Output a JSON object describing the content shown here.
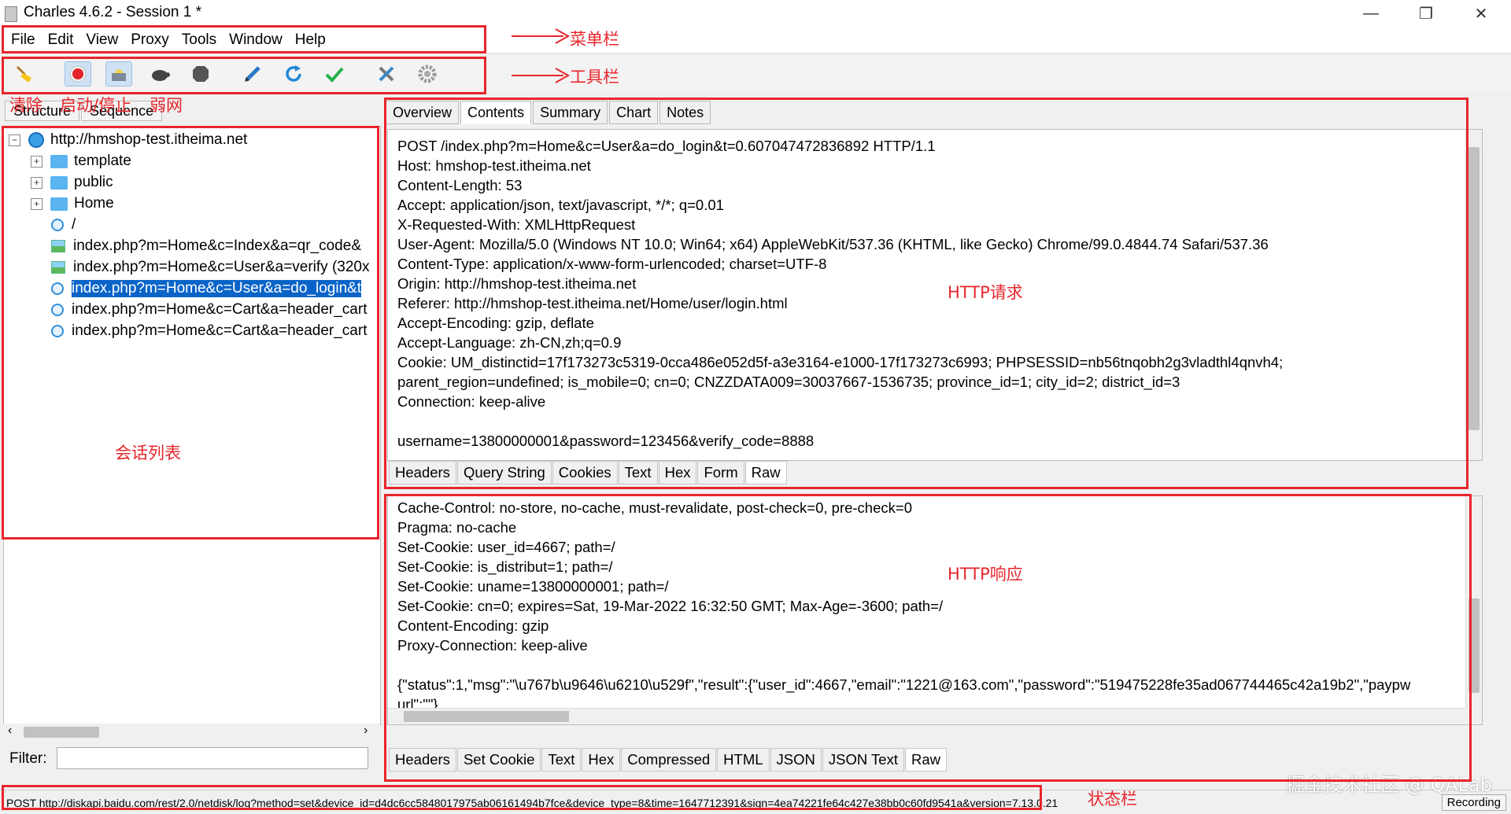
{
  "window": {
    "title": "Charles 4.6.2 - Session 1 *",
    "controls": [
      "—",
      "❐",
      "✕"
    ]
  },
  "menu": [
    "File",
    "Edit",
    "View",
    "Proxy",
    "Tools",
    "Window",
    "Help"
  ],
  "toolbar": {
    "buttons": [
      "broom-icon",
      "record-icon",
      "throttle-icon",
      "turtle-icon",
      "stop-icon",
      "pen-icon",
      "refresh-icon",
      "check-icon",
      "tools-icon",
      "gear-icon"
    ]
  },
  "annotations": {
    "menubar": "菜单栏",
    "toolbar": "工具栏",
    "clear": "清除",
    "start_stop": "启动/停止",
    "throttle": "弱网",
    "session_list": "会话列表",
    "http_request": "HTTP请求",
    "http_response": "HTTP响应",
    "statusbar": "状态栏",
    "accent_color": "#e8262c"
  },
  "left": {
    "tabs": [
      "Structure",
      "Sequence"
    ],
    "tree": {
      "host": "http://hmshop-test.itheima.net",
      "folders": [
        "template",
        "public",
        "Home"
      ],
      "items": [
        {
          "icon": "page",
          "label": "/"
        },
        {
          "icon": "image",
          "label": "index.php?m=Home&c=Index&a=qr_code&"
        },
        {
          "icon": "image",
          "label": "index.php?m=Home&c=User&a=verify (320x"
        },
        {
          "icon": "page",
          "label": "index.php?m=Home&c=User&a=do_login&t",
          "selected": true
        },
        {
          "icon": "page",
          "label": "index.php?m=Home&c=Cart&a=header_cart"
        },
        {
          "icon": "page",
          "label": "index.php?m=Home&c=Cart&a=header_cart"
        }
      ]
    },
    "filter_label": "Filter:",
    "filter_value": ""
  },
  "right": {
    "tabs": [
      "Overview",
      "Contents",
      "Summary",
      "Chart",
      "Notes"
    ],
    "selected_tab": "Contents",
    "request_lines": [
      "POST /index.php?m=Home&c=User&a=do_login&t=0.607047472836892 HTTP/1.1",
      "Host: hmshop-test.itheima.net",
      "Content-Length: 53",
      "Accept: application/json, text/javascript, */*; q=0.01",
      "X-Requested-With: XMLHttpRequest",
      "User-Agent: Mozilla/5.0 (Windows NT 10.0; Win64; x64) AppleWebKit/537.36 (KHTML, like Gecko) Chrome/99.0.4844.74 Safari/537.36",
      "Content-Type: application/x-www-form-urlencoded; charset=UTF-8",
      "Origin: http://hmshop-test.itheima.net",
      "Referer: http://hmshop-test.itheima.net/Home/user/login.html",
      "Accept-Encoding: gzip, deflate",
      "Accept-Language: zh-CN,zh;q=0.9",
      "Cookie: UM_distinctid=17f173273c5319-0cca486e052d5f-a3e3164-e1000-17f173273c6993; PHPSESSID=nb56tnqobh2g3vladthl4qnvh4;",
      "parent_region=undefined; is_mobile=0; cn=0; CNZZDATA009=30037667-1536735; province_id=1; city_id=2; district_id=3",
      "Connection: keep-alive",
      "",
      "username=13800000001&password=123456&verify_code=8888"
    ],
    "request_subtabs": [
      "Headers",
      "Query String",
      "Cookies",
      "Text",
      "Hex",
      "Form",
      "Raw"
    ],
    "request_selected_subtab": "Raw",
    "response_lines": [
      "Cache-Control: no-store, no-cache, must-revalidate, post-check=0, pre-check=0",
      "Pragma: no-cache",
      "Set-Cookie: user_id=4667; path=/",
      "Set-Cookie: is_distribut=1; path=/",
      "Set-Cookie: uname=13800000001; path=/",
      "Set-Cookie: cn=0; expires=Sat, 19-Mar-2022 16:32:50 GMT; Max-Age=-3600; path=/",
      "Content-Encoding: gzip",
      "Proxy-Connection: keep-alive",
      "",
      "{\"status\":1,\"msg\":\"\\u767b\\u9646\\u6210\\u529f\",\"result\":{\"user_id\":4667,\"email\":\"1221@163.com\",\"password\":\"519475228fe35ad067744465c42a19b2\",\"paypw",
      "url\":\"\"}"
    ],
    "response_subtabs": [
      "Headers",
      "Set Cookie",
      "Text",
      "Hex",
      "Compressed",
      "HTML",
      "JSON",
      "JSON Text",
      "Raw"
    ],
    "response_selected_subtab": "Raw"
  },
  "status": {
    "text": "POST http://diskapi.baidu.com/rest/2.0/netdisk/log?method=set&device_id=d4dc6cc5848017975ab06161494b7fce&device_type=8&time=1647712391&sign=4ea74221fe64c427e38bb0c60fd9541a&version=7.13.0.21",
    "recording": "Recording"
  },
  "watermark": "掘金技术社区 @ QALab"
}
